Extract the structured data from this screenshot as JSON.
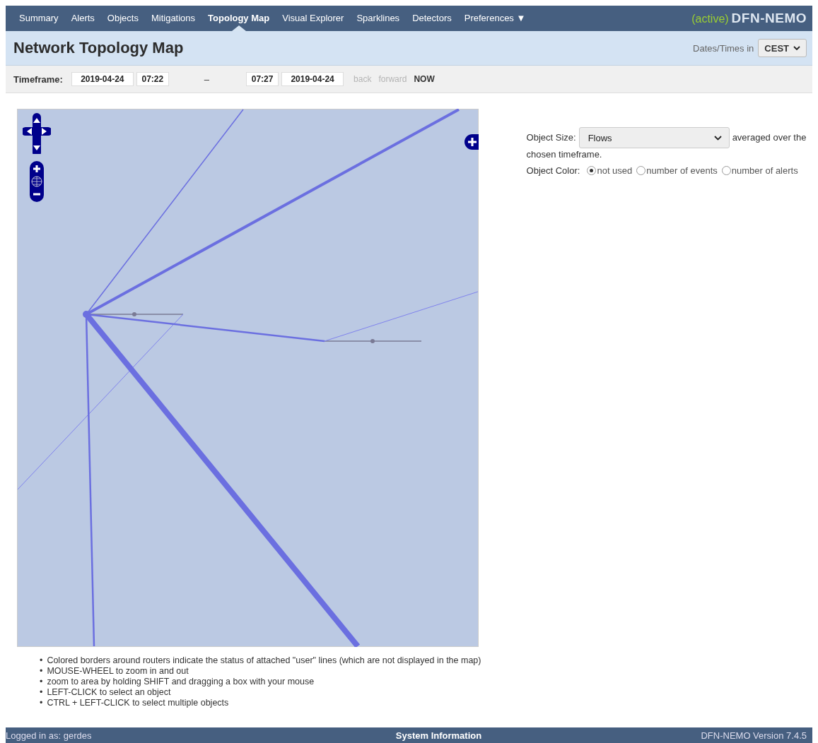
{
  "nav": {
    "items": [
      {
        "label": "Summary",
        "selected": false
      },
      {
        "label": "Alerts",
        "selected": false
      },
      {
        "label": "Objects",
        "selected": false
      },
      {
        "label": "Mitigations",
        "selected": false
      },
      {
        "label": "Topology Map",
        "selected": true
      },
      {
        "label": "Visual Explorer",
        "selected": false
      },
      {
        "label": "Sparklines",
        "selected": false
      },
      {
        "label": "Detectors",
        "selected": false
      }
    ],
    "menu": {
      "label": "Preferences",
      "caret": "▼"
    },
    "brand": {
      "status": "(active)",
      "name": "DFN-NEMO"
    }
  },
  "header": {
    "title": "Network Topology Map",
    "timezone_label": "Dates/Times in",
    "timezone": "CEST"
  },
  "timeframe": {
    "label": "Timeframe:",
    "start_date": "2019-04-24",
    "start_time": "07:22",
    "separator": "–",
    "end_time": "07:27",
    "end_date": "2019-04-24",
    "links": [
      {
        "label": "back",
        "disabled": true
      },
      {
        "label": "forward",
        "disabled": true
      },
      {
        "label": "NOW",
        "disabled": false
      }
    ]
  },
  "options": {
    "size_label": "Object Size:",
    "size_value": "Flows",
    "size_note_lines": [
      "averaged over the",
      "chosen timeframe."
    ],
    "color_label": "Object Color:",
    "color_options": [
      {
        "label": "not used",
        "selected": true
      },
      {
        "label": "number of events",
        "selected": false
      },
      {
        "label": "number of alerts",
        "selected": false
      }
    ]
  },
  "help_bullet": "•",
  "help": [
    "Colored borders around routers indicate the status of attached \"user\" lines (which are not displayed in the map)",
    "MOUSE-WHEEL to zoom in and out",
    "zoom to area by holding SHIFT and dragging a box with your mouse",
    "LEFT-CLICK to select an object",
    "CTRL + LEFT-CLICK to select multiple objects"
  ],
  "footer": {
    "user": "Logged in as: gerdes",
    "center": "System Information",
    "version": "DFN-NEMO Version 7.4.5"
  }
}
